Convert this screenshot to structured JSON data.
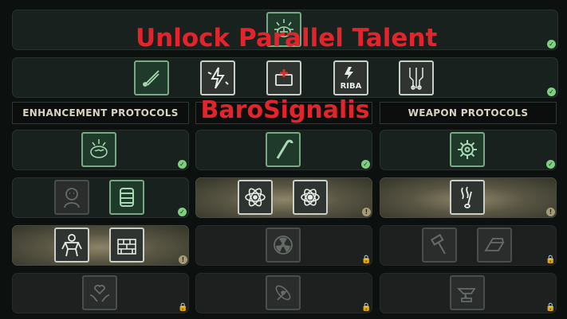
{
  "overlay": {
    "title": "Unlock Parallel Talent",
    "subtitle": "BaroSignalis"
  },
  "columns": {
    "enhancement": "ENHANCEMENT PROTOCOLS",
    "middle": "",
    "weapon": "WEAPON PROTOCOLS"
  },
  "colors": {
    "unlocked_border": "#78a886",
    "check": "#7ed07e",
    "available_glow": "#8d8569",
    "overlay_text": "#e4242c"
  },
  "rows": [
    {
      "tier": "core",
      "icons": [
        "brain-burst-icon"
      ],
      "status": "unlocked"
    },
    {
      "tier": "shared",
      "icons": [
        "scalpel-icon",
        "lightning-icon",
        "medkit-icon",
        "riba-badge-icon",
        "circuit-icon"
      ],
      "status": "unlocked"
    }
  ],
  "icon_labels": {
    "riba": "RIBA"
  },
  "status_glyphs": {
    "check": "✓",
    "warn": "!",
    "lock": "🔒"
  }
}
